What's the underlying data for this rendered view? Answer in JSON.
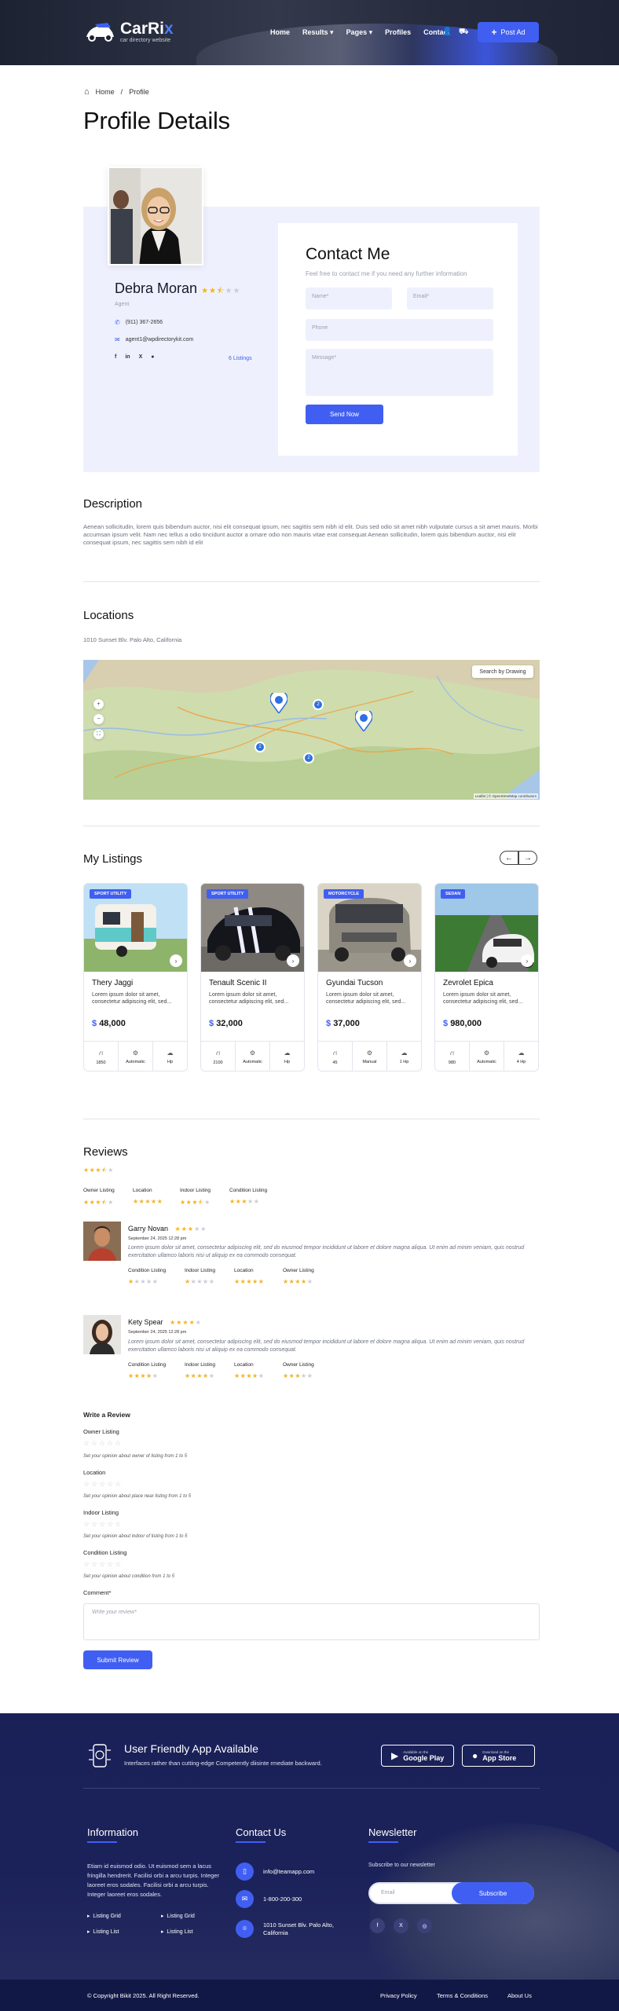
{
  "header": {
    "logo_main": "CarRi",
    "logo_accent": "x",
    "logo_sub": "car directory website",
    "nav": [
      "Home",
      "Results",
      "Pages",
      "Profiles",
      "Contact"
    ],
    "nav_dropdown": [
      "Results",
      "Pages"
    ],
    "post_ad": "Post Ad"
  },
  "breadcrumb": {
    "home": "Home",
    "sep": "/",
    "current": "Profile"
  },
  "page_title": "Profile Details",
  "profile": {
    "name": "Debra Moran",
    "role": "Agent",
    "rating": 2.5,
    "phone": "(911) 367-2656",
    "email": "agent1@wpdirectorykit.com",
    "listings_link": "6 Listings",
    "social": [
      "f",
      "in",
      "X",
      "tt"
    ]
  },
  "contact": {
    "title": "Contact Me",
    "subtitle": "Feel free to contact me if you need any further information",
    "name_ph": "Name*",
    "email_ph": "Email*",
    "phone_ph": "Phone",
    "message_ph": "Message*",
    "send": "Send Now"
  },
  "description": {
    "title": "Description",
    "text": "Aenean sollicitudin, lorem quis bibendum auctor, nisi elit consequat ipsum, nec sagittis sem nibh id elit. Duis sed odio sit amet nibh vulputate cursus a sit amet mauris. Morbi accumsan ipsum velit. Nam nec tellus a odio tincidunt auctor a ornare odio non mauris vitae erat consequat Aenean sollicitudin, lorem quis bibendum auctor, nisi elit consequat ipsum, nec sagittis sem nibh id elit"
  },
  "locations": {
    "title": "Locations",
    "address": "1010 Sunset Blv. Palo Alto, California",
    "search_drawing": "Search by Drawing",
    "zoom_in": "+",
    "zoom_out": "−",
    "fullscreen": "⛶",
    "clusters": [
      "2",
      "2",
      "2"
    ],
    "attribution": "Leaflet | © OpenStreetMap contributors"
  },
  "my_listings": {
    "title": "My Listings",
    "items": [
      {
        "badge": "SPORT UTILITY",
        "name": "Thery Jaggi",
        "desc": "Lorem ipsum dolor sit amet, consectetur adipiscing elit, sed...",
        "currency": "$",
        "price": "48,000",
        "specs": [
          "1850",
          "Automatic",
          "Hp"
        ]
      },
      {
        "badge": "SPORT UTILITY",
        "name": "Tenault Scenic II",
        "desc": "Lorem ipsum dolor sit amet, consectetur adipiscing elit, sed...",
        "currency": "$",
        "price": "32,000",
        "specs": [
          "2100",
          "Automatic",
          "Hp"
        ]
      },
      {
        "badge": "MOTORCYCLE",
        "name": "Gyundai Tucson",
        "desc": "Lorem ipsum dolor sit amet, consectetur adipiscing elit, sed...",
        "currency": "$",
        "price": "37,000",
        "specs": [
          "45",
          "Manual",
          "1 Hp"
        ]
      },
      {
        "badge": "SEDAN",
        "name": "Zevrolet Epica",
        "desc": "Lorem ipsum dolor sit amet, consectetur adipiscing elit, sed...",
        "currency": "$",
        "price": "980,000",
        "specs": [
          "980",
          "Automatic",
          "4 Hp"
        ]
      }
    ]
  },
  "reviews": {
    "title": "Reviews",
    "overall": 3.5,
    "categories": [
      {
        "label": "Owner Listing",
        "rating": 3.5
      },
      {
        "label": "Location",
        "rating": 5
      },
      {
        "label": "Indoor Listing",
        "rating": 3.5
      },
      {
        "label": "Condition Listing",
        "rating": 3
      }
    ],
    "items": [
      {
        "name": "Garry Novan",
        "rating": 3,
        "date": "September 24, 2025 12:28 pm",
        "text": "Lorem ipsum dolor sit amet, consectetur adipiscing elit, sed do eiusmod tempor incididunt ut labore et dolore magna aliqua. Ut enim ad minim veniam, quis nostrud exercitation ullamco laboris nisi ut aliquip ex ea commodo consequat.",
        "cats": [
          {
            "label": "Condition Listing",
            "rating": 1
          },
          {
            "label": "Indoor Listing",
            "rating": 1
          },
          {
            "label": "Location",
            "rating": 5
          },
          {
            "label": "Owner Listing",
            "rating": 4
          }
        ]
      },
      {
        "name": "Kety Spear",
        "rating": 4,
        "date": "September 24, 2025 12:28 pm",
        "text": "Lorem ipsum dolor sit amet, consectetur adipiscing elit, sed do eiusmod tempor incididunt ut labore et dolore magna aliqua. Ut enim ad minim veniam, quis nostrud exercitation ullamco laboris nisi ut aliquip ex ea commodo consequat.",
        "cats": [
          {
            "label": "Condition Listing",
            "rating": 4
          },
          {
            "label": "Indoor Listing",
            "rating": 4
          },
          {
            "label": "Location",
            "rating": 4
          },
          {
            "label": "Owner Listing",
            "rating": 3
          }
        ]
      }
    ]
  },
  "write_review": {
    "title": "Write a Review",
    "fields": [
      {
        "label": "Owner Listing",
        "hint": "Set your opinion about owner of listing from 1 to 5"
      },
      {
        "label": "Location",
        "hint": "Set your opinion about place near listing from 1 to 5"
      },
      {
        "label": "Indoor Listing",
        "hint": "Set your opinion about indoor of listing from 1 to 5"
      },
      {
        "label": "Condition Listing",
        "hint": "Set your opinion about condition from 1 to 5"
      }
    ],
    "comment_label": "Comment*",
    "comment_ph": "Write your review*",
    "submit": "Submit Review"
  },
  "footer": {
    "app_title": "User Friendly App Available",
    "app_sub": "Interfaces rather than cutting-edge Competently diisinte rmediate backward.",
    "google_small": "Available on the",
    "google": "Google Play",
    "apple_small": "Download on the",
    "apple": "App Store",
    "info_title": "Information",
    "info_text": "Etiam id euismod odio. Ut euismod sem a lacus fringilla hendrerit. Facilisi orbi a arcu turpis. Integer laoreet eros sodales. Facilisi orbi a arcu turpis. Integer laoreet eros sodales.",
    "info_links": [
      "Listing Grid",
      "Listing Grid",
      "Listing List",
      "Listing List"
    ],
    "contact_title": "Contact Us",
    "contact_email": "info@teamapp.com",
    "contact_phone": "1-800-200-300",
    "contact_address": "1010 Sunset Blv. Palo Alto, California",
    "newsletter_title": "Newsletter",
    "newsletter_sub": "Subscribe to our newsletter",
    "email_ph": "Email",
    "subscribe": "Subscribe",
    "copyright": "© Copyright Bikit 2025. All Right Reserved.",
    "bottom_links": [
      "Privacy Policy",
      "Terms & Conditions",
      "About Us"
    ]
  },
  "colors": {
    "accent": "#405ff2",
    "star": "#f6b31a",
    "footer": "#1a2157"
  }
}
